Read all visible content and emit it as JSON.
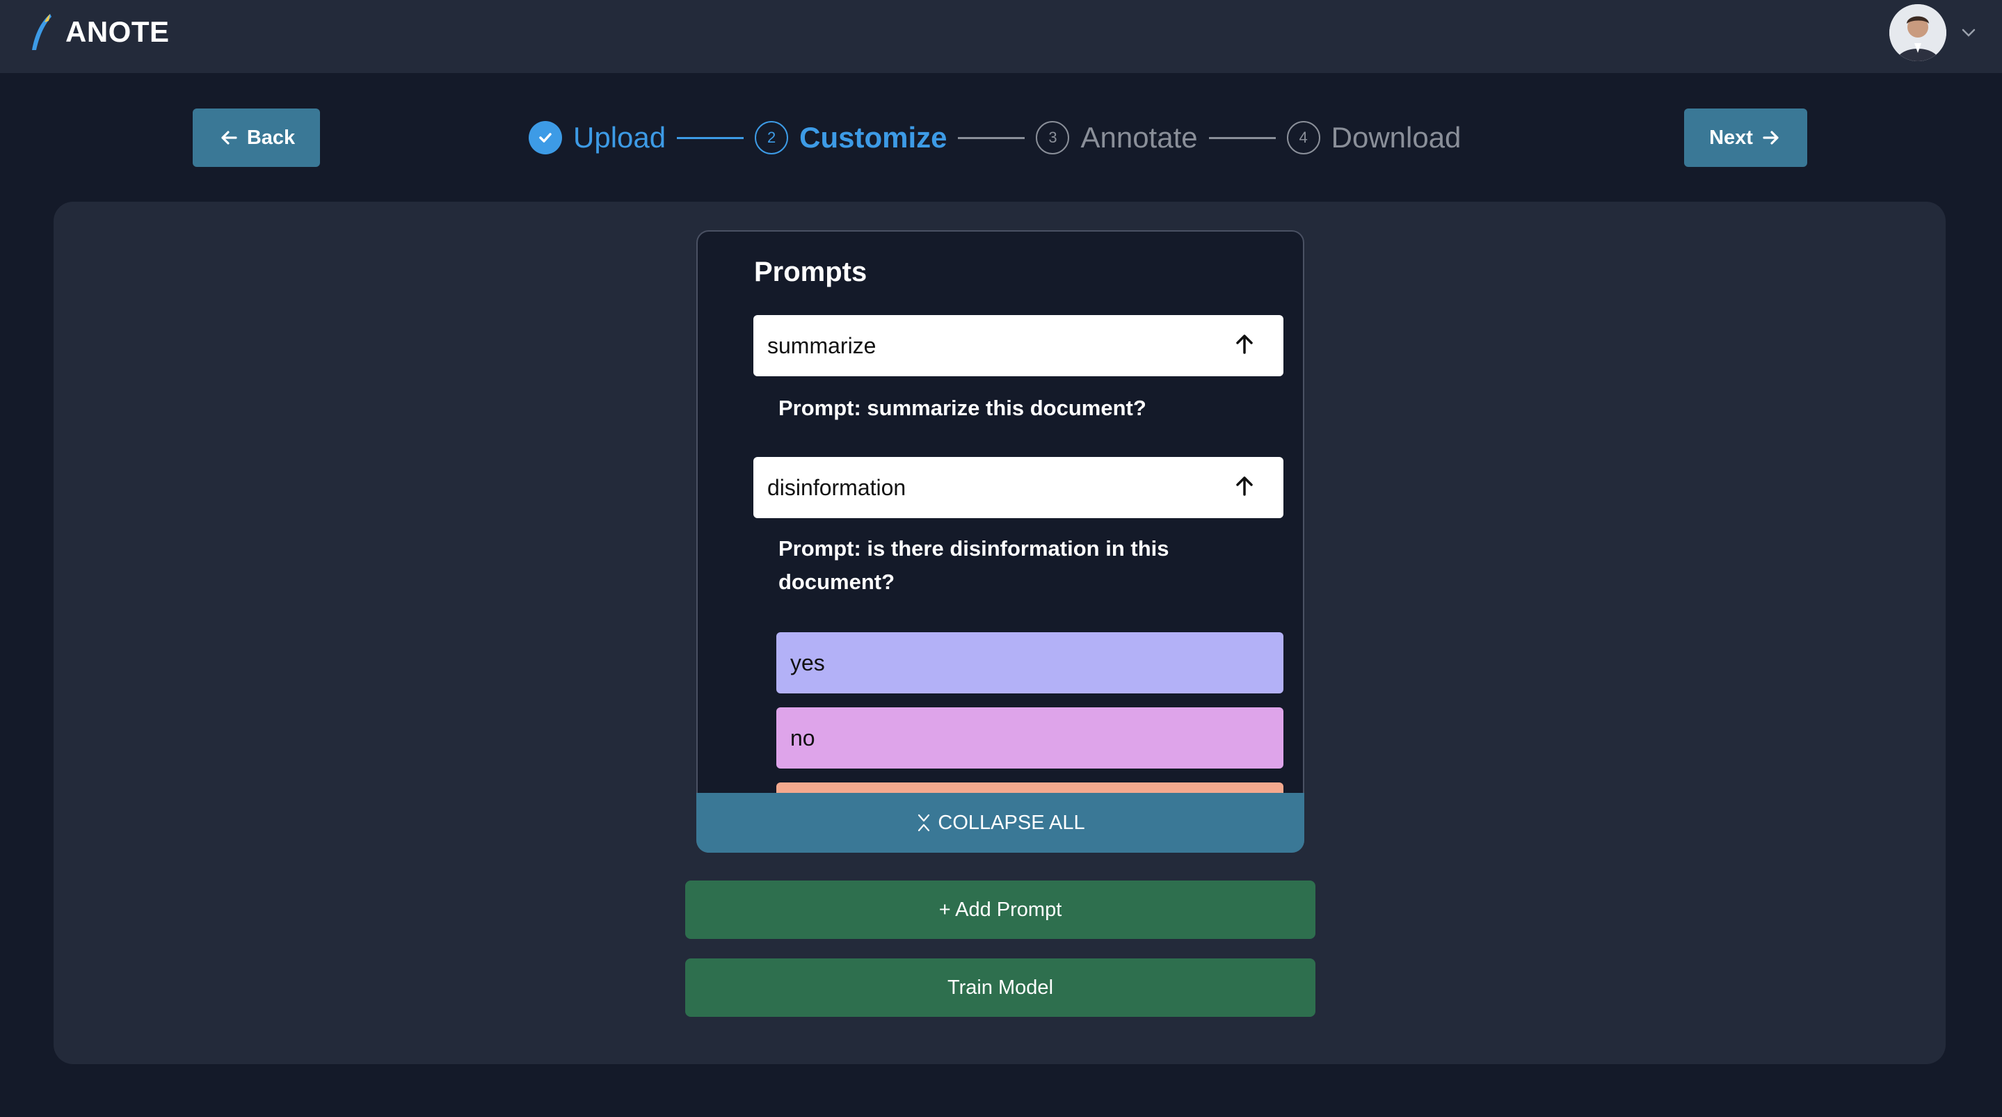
{
  "app": {
    "name": "ANOTE"
  },
  "nav": {
    "back_label": "Back",
    "next_label": "Next"
  },
  "steps": [
    {
      "number": "",
      "label": "Upload",
      "state": "done"
    },
    {
      "number": "2",
      "label": "Customize",
      "state": "active"
    },
    {
      "number": "3",
      "label": "Annotate",
      "state": "pending"
    },
    {
      "number": "4",
      "label": "Download",
      "state": "pending"
    }
  ],
  "prompts": {
    "title": "Prompts",
    "items": [
      {
        "name": "summarize",
        "text": "Prompt: summarize this document?"
      },
      {
        "name": "disinformation",
        "text": "Prompt: is there disinformation in this document?"
      }
    ],
    "options": [
      {
        "label": "yes",
        "color": "#b3b1f7"
      },
      {
        "label": "no",
        "color": "#dea4ea"
      },
      {
        "label": "",
        "color": "#f4a98e"
      }
    ],
    "collapse_label": "COLLAPSE ALL"
  },
  "actions": {
    "add_prompt": "+ Add Prompt",
    "train_model": "Train Model"
  },
  "colors": {
    "accent": "#3d9be6",
    "button": "#3a7896",
    "green": "#2e6f4e",
    "background": "#141a29",
    "surface": "#232a3a"
  }
}
